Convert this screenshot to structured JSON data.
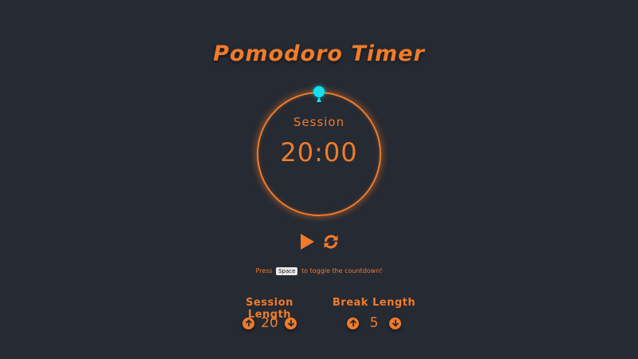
{
  "app": {
    "title": "Pomodoro Timer"
  },
  "timer": {
    "label": "Session",
    "time": "20:00"
  },
  "controls": {
    "play_icon": "play-icon",
    "reset_icon": "refresh-icon"
  },
  "hint": {
    "prefix": "Press",
    "key": "Space",
    "suffix": "to toggle the countdown!"
  },
  "session": {
    "title": "Session Length",
    "value": "20"
  },
  "break": {
    "title": "Break Length",
    "value": "5"
  },
  "colors": {
    "background": "#262a33",
    "accent": "#f07b2a",
    "progress": "#14e0f0"
  }
}
